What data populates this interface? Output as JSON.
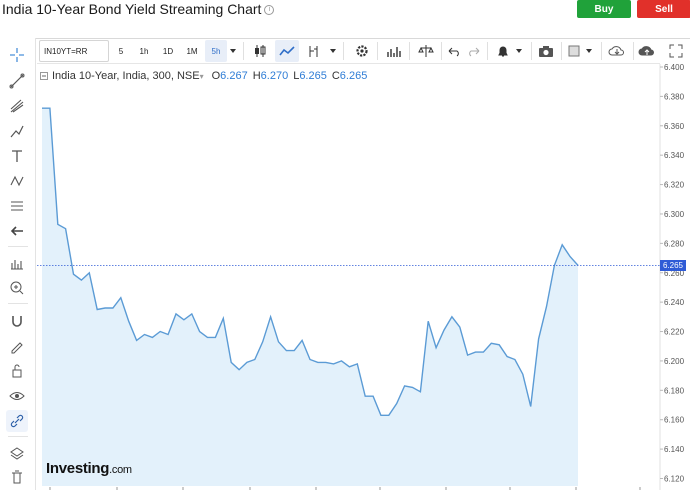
{
  "header": {
    "title": "India 10-Year Bond Yield Streaming Chart",
    "info_glyph": "i",
    "buy_label": "Buy",
    "sell_label": "Sell"
  },
  "toolbar": {
    "symbol": "IN10YT=RR",
    "intervals": [
      "5",
      "1h",
      "1D",
      "1M",
      "5h"
    ],
    "active_interval": "5h"
  },
  "legend": {
    "name": "India 10-Year, India, 300, NSE",
    "open_label": "O",
    "open": "6.267",
    "high_label": "H",
    "high": "6.270",
    "low_label": "L",
    "low": "6.265",
    "close_label": "C",
    "close": "6.265"
  },
  "current_price": "6.265",
  "logo": {
    "brand": "Investing",
    "suffix": ".com"
  },
  "colors": {
    "line": "#5b9bd5",
    "fill": "#e3f1fb",
    "buy": "#20a23a",
    "sell": "#e1302a",
    "price_tag": "#2f5bd6"
  },
  "chart_data": {
    "type": "area",
    "title": "India 10-Year, India, 300, NSE",
    "y_ticks": [
      "6.400",
      "6.380",
      "6.360",
      "6.340",
      "6.320",
      "6.300",
      "6.280",
      "6.260",
      "6.240",
      "6.220",
      "6.200",
      "6.180",
      "6.160",
      "6.140",
      "6.120"
    ],
    "ylim": [
      6.11,
      6.4
    ],
    "grid": false,
    "values": [
      6.372,
      6.372,
      6.293,
      6.29,
      6.259,
      6.255,
      6.26,
      6.235,
      6.236,
      6.236,
      6.243,
      6.227,
      6.214,
      6.218,
      6.216,
      6.22,
      6.218,
      6.232,
      6.228,
      6.232,
      6.22,
      6.216,
      6.216,
      6.229,
      6.199,
      6.194,
      6.199,
      6.201,
      6.213,
      6.23,
      6.213,
      6.207,
      6.207,
      6.214,
      6.201,
      6.199,
      6.199,
      6.198,
      6.2,
      6.196,
      6.198,
      6.176,
      6.176,
      6.163,
      6.163,
      6.171,
      6.183,
      6.182,
      6.179,
      6.227,
      6.209,
      6.221,
      6.23,
      6.223,
      6.204,
      6.206,
      6.206,
      6.212,
      6.211,
      6.203,
      6.201,
      6.191,
      6.169,
      6.215,
      6.237,
      6.265,
      6.279,
      6.271,
      6.265
    ]
  }
}
